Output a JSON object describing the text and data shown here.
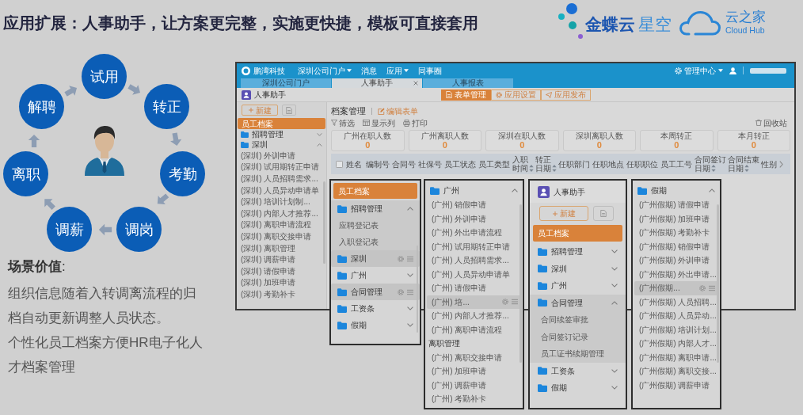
{
  "title": "应用扩展：人事助手，让方案更完整，实施更快捷，模板可直接套用",
  "logos": [
    {
      "kind": "kingdee",
      "name": "金蝶云",
      "product": "星空"
    },
    {
      "kind": "cloudhub",
      "name": "云之家",
      "tagline": "Cloud Hub"
    }
  ],
  "lifecycle": {
    "stages": [
      "试用",
      "转正",
      "考勤",
      "调岗",
      "调薪",
      "离职",
      "解聘"
    ]
  },
  "scene_value": {
    "heading": "**场景价值**:",
    "paragraphs": [
      "组织信息随着入转调离流程的归档自动更新调整人员状态。",
      "个性化员工档案方便HR电子化人才档案管理"
    ]
  },
  "app_window": {
    "brand": "鹏湾科技",
    "nav": [
      {
        "label": "深圳公司门户",
        "dropdown": true
      },
      {
        "label": "消息",
        "dropdown": false
      },
      {
        "label": "应用",
        "dropdown": true
      },
      {
        "label": "同事圈",
        "dropdown": false
      }
    ],
    "admin_menu": {
      "label": "管理中心",
      "dropdown": true
    },
    "tabs": [
      {
        "label": "深圳公司门户",
        "selected": false,
        "closable": false
      },
      {
        "label": "人事助手",
        "selected": true,
        "closable": true
      },
      {
        "label": "人事报表",
        "selected": false,
        "closable": false
      }
    ],
    "app_name": "人事助手",
    "header_buttons": [
      {
        "kind": "forms",
        "label": "表单管理",
        "selected": true
      },
      {
        "kind": "settings",
        "label": "应用设置",
        "selected": false
      },
      {
        "kind": "publish",
        "label": "应用发布",
        "selected": false
      }
    ],
    "new_button": "新建",
    "sidebar": [
      {
        "kind": "page",
        "label": "员工档案",
        "selected": true,
        "hovered": false
      },
      {
        "kind": "folder",
        "label": "招聘管理",
        "selected": false,
        "hovered": false,
        "expanded": false
      },
      {
        "kind": "folder",
        "label": "深圳",
        "selected": false,
        "hovered": false,
        "expanded": true,
        "children": [
          {
            "kind": "item",
            "label": "(深圳) 外训申请",
            "selected": false,
            "hovered": false
          },
          {
            "kind": "item",
            "label": "(深圳) 试用期转正申请",
            "selected": false,
            "hovered": false
          },
          {
            "kind": "item",
            "label": "(深圳) 人员招聘需求...",
            "selected": false,
            "hovered": false
          },
          {
            "kind": "item",
            "label": "(深圳) 人员异动申请单",
            "selected": false,
            "hovered": false
          },
          {
            "kind": "item",
            "label": "(深圳) 培训计划制...",
            "selected": false,
            "hovered": false
          },
          {
            "kind": "item",
            "label": "(深圳) 内部人才推荐...",
            "selected": false,
            "hovered": false
          },
          {
            "kind": "item",
            "label": "(深圳) 离职申请流程",
            "selected": false,
            "hovered": false
          },
          {
            "kind": "item",
            "label": "(深圳) 离职交接申请",
            "selected": false,
            "hovered": false
          },
          {
            "kind": "item",
            "label": "(深圳) 离职管理",
            "selected": false,
            "hovered": false
          },
          {
            "kind": "item",
            "label": "(深圳) 调薪申请",
            "selected": false,
            "hovered": false
          },
          {
            "kind": "item",
            "label": "(深圳) 请假申请",
            "selected": false,
            "hovered": false
          },
          {
            "kind": "item",
            "label": "(深圳) 加班申请",
            "selected": false,
            "hovered": false
          },
          {
            "kind": "item",
            "label": "(深圳) 考勤补卡",
            "selected": false,
            "hovered": false
          }
        ]
      }
    ],
    "page_title": "档案管理",
    "edit_link": "编辑表单",
    "toolbar": [
      {
        "kind": "filter",
        "label": "筛选"
      },
      {
        "kind": "columns",
        "label": "显示列"
      },
      {
        "kind": "print",
        "label": "打印"
      }
    ],
    "recycle_bin": "回收站",
    "stats": [
      {
        "label": "广州在职人数",
        "value": "0"
      },
      {
        "label": "广州离职人数",
        "value": "0"
      },
      {
        "label": "深圳在职人数",
        "value": "0"
      },
      {
        "label": "深圳离职人数",
        "value": "0"
      },
      {
        "label": "本周转正",
        "value": "0"
      },
      {
        "label": "本月转正",
        "value": "0"
      }
    ],
    "table": {
      "select_all_checked": false,
      "columns": [
        {
          "label": "姓名",
          "sortable": false
        },
        {
          "label": "编制号",
          "sortable": false
        },
        {
          "label": "合同号",
          "sortable": false
        },
        {
          "label": "社保号",
          "sortable": false
        },
        {
          "label": "员工状态",
          "sortable": false
        },
        {
          "label": "员工类型",
          "sortable": false
        },
        {
          "label": "入职时间",
          "sortable": true
        },
        {
          "label": "转正日期",
          "sortable": true
        },
        {
          "label": "任职部门",
          "sortable": false
        },
        {
          "label": "任职地点",
          "sortable": false
        },
        {
          "label": "任职职位",
          "sortable": false
        },
        {
          "label": "员工工号",
          "sortable": false
        },
        {
          "label": "合同签订日期",
          "sortable": true
        },
        {
          "label": "合同结束日期",
          "sortable": true
        },
        {
          "label": "性别",
          "sortable": false
        }
      ]
    }
  },
  "panels": [
    {
      "kind": "tree",
      "tree": [
        {
          "kind": "page",
          "label": "员工档案",
          "selected": true,
          "hovered": false
        },
        {
          "kind": "folder",
          "label": "招聘管理",
          "selected": false,
          "hovered": false,
          "expanded": true,
          "children": [
            {
              "kind": "item",
              "label": "应聘登记表",
              "selected": false,
              "hovered": false
            },
            {
              "kind": "item",
              "label": "入职登记表",
              "selected": false,
              "hovered": false
            }
          ]
        },
        {
          "kind": "folder",
          "label": "深圳",
          "selected": false,
          "hovered": true
        },
        {
          "kind": "folder",
          "label": "广州",
          "selected": false,
          "hovered": false,
          "expanded": false
        },
        {
          "kind": "folder",
          "label": "合同管理",
          "selected": false,
          "hovered": true
        },
        {
          "kind": "folder",
          "label": "工资条",
          "selected": false,
          "hovered": false,
          "expanded": false
        },
        {
          "kind": "folder",
          "label": "假期",
          "selected": false,
          "hovered": false,
          "expanded": false
        }
      ]
    },
    {
      "kind": "folder",
      "tree": [
        {
          "kind": "folder",
          "label": "广州",
          "selected": false,
          "hovered": false,
          "expanded": true,
          "children": [
            {
              "kind": "item",
              "label": "(广州) 销假申请",
              "selected": false,
              "hovered": false
            },
            {
              "kind": "item",
              "label": "(广州) 外训申请",
              "selected": false,
              "hovered": false
            },
            {
              "kind": "item",
              "label": "(广州) 外出申请流程",
              "selected": false,
              "hovered": false
            },
            {
              "kind": "item",
              "label": "(广州) 试用期转正申请",
              "selected": false,
              "hovered": false
            },
            {
              "kind": "item",
              "label": "(广州) 人员招聘需求...",
              "selected": false,
              "hovered": false
            },
            {
              "kind": "item",
              "label": "(广州) 人员异动申请单",
              "selected": false,
              "hovered": false
            },
            {
              "kind": "item",
              "label": "(广州) 请假申请",
              "selected": false,
              "hovered": false
            },
            {
              "kind": "item",
              "label": "(广州) 培...",
              "selected": false,
              "hovered": true
            },
            {
              "kind": "item",
              "label": "(广州) 内部人才推荐...",
              "selected": false,
              "hovered": false
            },
            {
              "kind": "item",
              "label": "(广州) 离职申请流程",
              "selected": false,
              "hovered": false
            },
            {
              "kind": "section",
              "label": "离职管理",
              "selected": false,
              "hovered": false
            },
            {
              "kind": "item",
              "label": "(广州) 离职交接申请",
              "selected": false,
              "hovered": false
            },
            {
              "kind": "item",
              "label": "(广州) 加班申请",
              "selected": false,
              "hovered": false
            },
            {
              "kind": "item",
              "label": "(广州) 调薪申请",
              "selected": false,
              "hovered": false
            },
            {
              "kind": "item",
              "label": "(广州) 考勤补卡",
              "selected": false,
              "hovered": false
            }
          ]
        }
      ]
    },
    {
      "kind": "app",
      "app_name": "人事助手",
      "new_button": "新建",
      "tree": [
        {
          "kind": "page",
          "label": "员工档案",
          "selected": true,
          "hovered": false
        },
        {
          "kind": "folder",
          "label": "招聘管理",
          "selected": false,
          "hovered": false,
          "expanded": false
        },
        {
          "kind": "folder",
          "label": "深圳",
          "selected": false,
          "hovered": false,
          "expanded": false
        },
        {
          "kind": "folder",
          "label": "广州",
          "selected": false,
          "hovered": false,
          "expanded": false
        },
        {
          "kind": "folder",
          "label": "合同管理",
          "selected": false,
          "hovered": false,
          "expanded": true,
          "children": [
            {
              "kind": "item",
              "label": "合同续签审批",
              "selected": false,
              "hovered": false
            },
            {
              "kind": "item",
              "label": "合同签订记录",
              "selected": false,
              "hovered": false
            },
            {
              "kind": "item",
              "label": "员工证书续期管理",
              "selected": false,
              "hovered": false
            }
          ]
        },
        {
          "kind": "folder",
          "label": "工资条",
          "selected": false,
          "hovered": false,
          "expanded": false
        },
        {
          "kind": "folder",
          "label": "假期",
          "selected": false,
          "hovered": false,
          "expanded": false
        }
      ]
    },
    {
      "kind": "folder",
      "tree": [
        {
          "kind": "folder",
          "label": "假期",
          "selected": false,
          "hovered": false,
          "expanded": true,
          "children": [
            {
              "kind": "item",
              "label": "(广州假期) 请假申请",
              "selected": false,
              "hovered": false
            },
            {
              "kind": "item",
              "label": "(广州假期) 加班申请",
              "selected": false,
              "hovered": false
            },
            {
              "kind": "item",
              "label": "(广州假期) 考勤补卡",
              "selected": false,
              "hovered": false
            },
            {
              "kind": "item",
              "label": "(广州假期) 销假申请",
              "selected": false,
              "hovered": false
            },
            {
              "kind": "item",
              "label": "(广州假期) 外训申请",
              "selected": false,
              "hovered": false
            },
            {
              "kind": "item",
              "label": "(广州假期) 外出申请...",
              "selected": false,
              "hovered": false
            },
            {
              "kind": "item",
              "label": "(广州假期...",
              "selected": false,
              "hovered": true
            },
            {
              "kind": "item",
              "label": "(广州假期) 人员招聘...",
              "selected": false,
              "hovered": false
            },
            {
              "kind": "item",
              "label": "(广州假期) 人员异动...",
              "selected": false,
              "hovered": false
            },
            {
              "kind": "item",
              "label": "(广州假期) 培训计划...",
              "selected": false,
              "hovered": false
            },
            {
              "kind": "item",
              "label": "(广州假期) 内部人才...",
              "selected": false,
              "hovered": false
            },
            {
              "kind": "item",
              "label": "(广州假期) 离职申请...",
              "selected": false,
              "hovered": false
            },
            {
              "kind": "item",
              "label": "(广州假期) 离职交接...",
              "selected": false,
              "hovered": false
            },
            {
              "kind": "item",
              "label": "(广州假期) 调薪申请",
              "selected": false,
              "hovered": false
            }
          ]
        }
      ]
    }
  ]
}
